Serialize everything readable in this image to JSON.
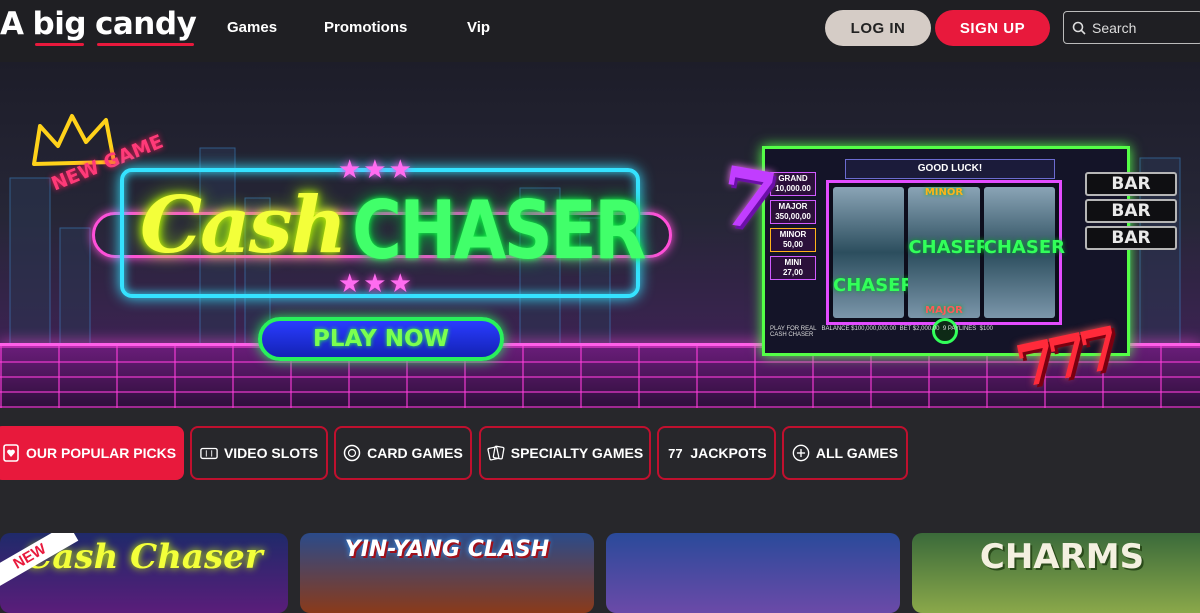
{
  "header": {
    "logo_words": [
      "A",
      "big",
      "candy"
    ],
    "nav": [
      "Games",
      "Promotions",
      "Vip"
    ],
    "login_label": "LOG IN",
    "signup_label": "SIGN UP",
    "search_placeholder": "Search"
  },
  "banner": {
    "badge": "NEW GAME",
    "title_script": "Cash",
    "title_block": "CHASER",
    "cta_label": "PLAY NOW",
    "machine": {
      "header": "GOOD LUCK!",
      "logo": "Cash CHASER",
      "jackpots": [
        {
          "name": "GRAND",
          "value": "10,000.00"
        },
        {
          "name": "MAJOR",
          "value": "350,00,00"
        },
        {
          "name": "MINOR",
          "value": "50,00"
        },
        {
          "name": "MINI",
          "value": "27,00"
        }
      ],
      "play_for_real": "PLAY FOR REAL",
      "balance_label": "BALANCE",
      "balance_value": "$100,000,000.00",
      "bet_label": "BET",
      "bet_value": "$2,000.00",
      "paylines": "9 PAYLINES",
      "win_value": "$100",
      "game_name": "CASH CHASER",
      "reel_symbols": [
        "CHASER",
        "CHASER",
        "CHASER",
        "MINOR",
        "MAJOR"
      ],
      "bar_symbols": [
        "BAR",
        "BAR",
        "BAR"
      ],
      "seven": "7",
      "triple_seven": "777"
    }
  },
  "categories": [
    {
      "label": "OUR POPULAR PICKS",
      "icon": "heart-card-icon",
      "active": true
    },
    {
      "label": "VIDEO SLOTS",
      "icon": "slot-machine-icon",
      "active": false
    },
    {
      "label": "CARD GAMES",
      "icon": "poker-chip-icon",
      "active": false
    },
    {
      "label": "SPECIALTY GAMES",
      "icon": "cards-icon",
      "active": false
    },
    {
      "label": "JACKPOTS",
      "icon": "sevens-icon",
      "active": false
    },
    {
      "label": "ALL GAMES",
      "icon": "plus-circle-icon",
      "active": false
    }
  ],
  "games": [
    {
      "title": "Cash Chaser",
      "ribbon": "NEW"
    },
    {
      "title": "YIN-YANG CLASH",
      "ribbon": ""
    },
    {
      "title": "",
      "ribbon": ""
    },
    {
      "title": "CHARMS",
      "ribbon": ""
    }
  ],
  "colors": {
    "accent": "#e8193c",
    "header_bg": "#1f1f23",
    "page_bg": "#27272b",
    "login_bg": "#d5ccc6"
  }
}
